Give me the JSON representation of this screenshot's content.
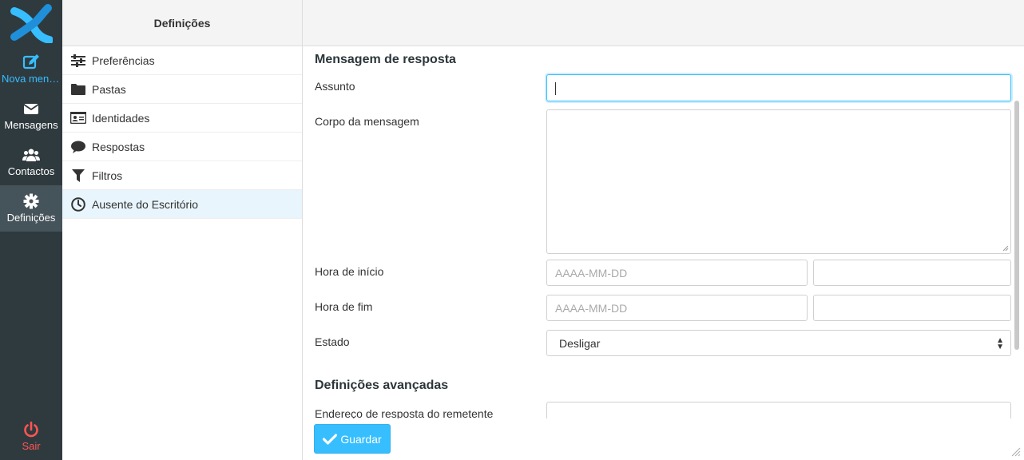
{
  "nav": {
    "compose": "Nova mens...",
    "mail": "Mensagens",
    "contacts": "Contactos",
    "settings": "Definições",
    "logout": "Sair"
  },
  "settings_list": {
    "header": "Definições",
    "items": [
      {
        "label": "Preferências",
        "icon": "sliders-icon"
      },
      {
        "label": "Pastas",
        "icon": "folder-icon"
      },
      {
        "label": "Identidades",
        "icon": "id-card-icon"
      },
      {
        "label": "Respostas",
        "icon": "comment-icon"
      },
      {
        "label": "Filtros",
        "icon": "filter-icon"
      },
      {
        "label": "Ausente do Escritório",
        "icon": "clock-icon",
        "selected": true
      }
    ]
  },
  "form": {
    "section_reply": "Mensagem de resposta",
    "subject_label": "Assunto",
    "subject_value": "",
    "body_label": "Corpo da mensagem",
    "body_value": "",
    "start_label": "Hora de início",
    "start_date_placeholder": "AAAA-MM-DD",
    "start_time_value": "",
    "end_label": "Hora de fim",
    "end_date_placeholder": "AAAA-MM-DD",
    "end_time_value": "",
    "status_label": "Estado",
    "status_value": "Desligar",
    "section_advanced": "Definições avançadas",
    "sender_label": "Endereço de resposta do remetente"
  },
  "footer": {
    "save_label": "Guardar"
  },
  "colors": {
    "accent": "#37beff",
    "nav_bg": "#2f3a3f",
    "logout": "#ff5552"
  }
}
